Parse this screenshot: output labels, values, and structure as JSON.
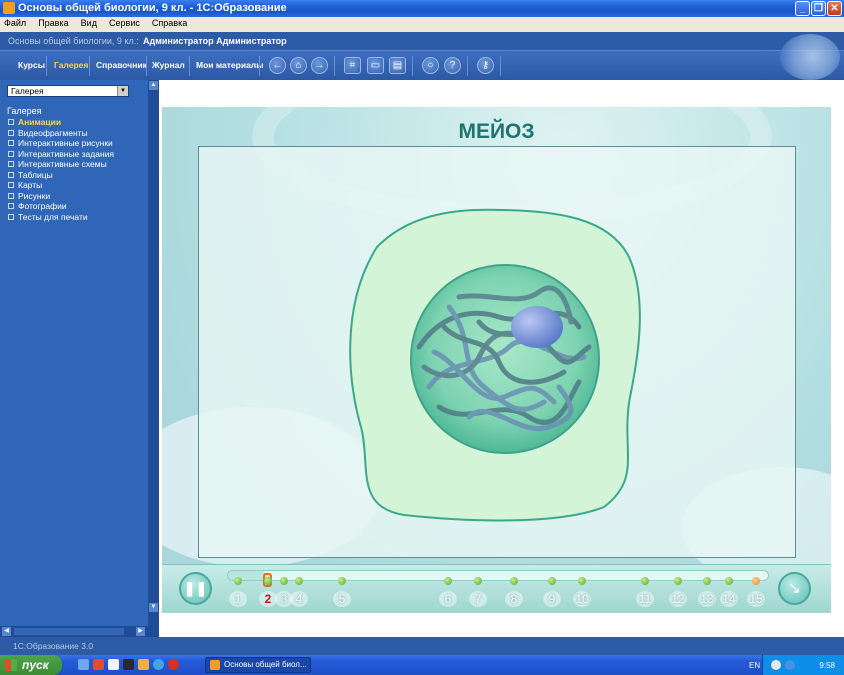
{
  "window": {
    "title": "Основы общей биологии, 9 кл. - 1С:Образование"
  },
  "menu": [
    "Файл",
    "Правка",
    "Вид",
    "Сервис",
    "Справка"
  ],
  "header": {
    "course": "Основы общей биологии, 9 кл.:",
    "user": "Администратор Администратор"
  },
  "nav": [
    {
      "label": "Курсы",
      "active": false
    },
    {
      "label": "Галерея",
      "active": true
    },
    {
      "label": "Справочник",
      "active": false
    },
    {
      "label": "Журнал",
      "active": false
    },
    {
      "label": "Мои материалы",
      "active": false
    }
  ],
  "toolbar_icons": [
    "back-icon",
    "home-icon",
    "forward-icon",
    "fit-icon",
    "presentation-icon",
    "print-icon",
    "search-icon",
    "help-icon",
    "key-icon"
  ],
  "sidebar": {
    "dropdown_value": "Галерея",
    "root": "Галерея",
    "items": [
      "Анимации",
      "Видеофрагменты",
      "Интерактивные рисунки",
      "Интерактивные задания",
      "Интерактивные схемы",
      "Таблицы",
      "Карты",
      "Рисунки",
      "Фотографии",
      "Тесты для печати"
    ],
    "active_index": 0
  },
  "animation": {
    "title": "МЕЙОЗ",
    "steps": [
      "1",
      "2",
      "3",
      "4",
      "5",
      "6",
      "7",
      "8",
      "9",
      "10",
      "11",
      "12",
      "13",
      "14",
      "15"
    ],
    "current_step": "2",
    "progress": 0.07
  },
  "status": {
    "text": "1С:Образование 3.0"
  },
  "taskbar": {
    "start_label": "пуск",
    "task_label": "Основы общей биол...",
    "lang": "EN",
    "clock": "9:58"
  },
  "colors": {
    "title_blue": "#1d5fd6",
    "panel_blue": "#2f66b8",
    "active_nav": "#ffd24a",
    "stage_title": "#1f7470",
    "current_step": "#c0181b"
  }
}
